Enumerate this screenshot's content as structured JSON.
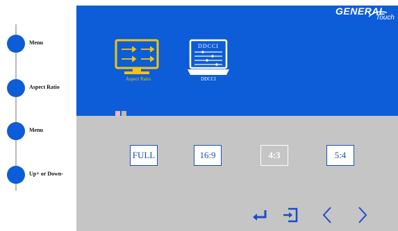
{
  "guide": {
    "items": [
      {
        "label": "Menu"
      },
      {
        "label": "Aspect Ratio"
      },
      {
        "label": "Menu"
      },
      {
        "label": "Up+ or Down-"
      }
    ]
  },
  "brand": {
    "general": "GENERAL",
    "touch": "Touch"
  },
  "menu": {
    "items": [
      {
        "label": "Aspect Ratio",
        "icon": "aspect-ratio-icon",
        "color": "#f2c40d",
        "active": true
      },
      {
        "label": "DDCCI",
        "icon": "ddcci-icon",
        "color": "#ffffff",
        "active": false,
        "icon_text": "DDCCI"
      }
    ]
  },
  "page_indicator": {
    "current": 1,
    "total": 2
  },
  "aspect": {
    "options": [
      {
        "label": "FULL",
        "selected": false
      },
      {
        "label": "16:9",
        "selected": false
      },
      {
        "label": "4:3",
        "selected": true
      },
      {
        "label": "5:4",
        "selected": false
      }
    ]
  },
  "nav": [
    "enter-icon",
    "exit-icon",
    "chevron-left-icon",
    "chevron-right-icon"
  ],
  "colors": {
    "osd_blue": "#0d5cd8",
    "osd_gray": "#c5c5c5",
    "highlight": "#f2c40d",
    "guide_dot": "#0d5cd8"
  }
}
